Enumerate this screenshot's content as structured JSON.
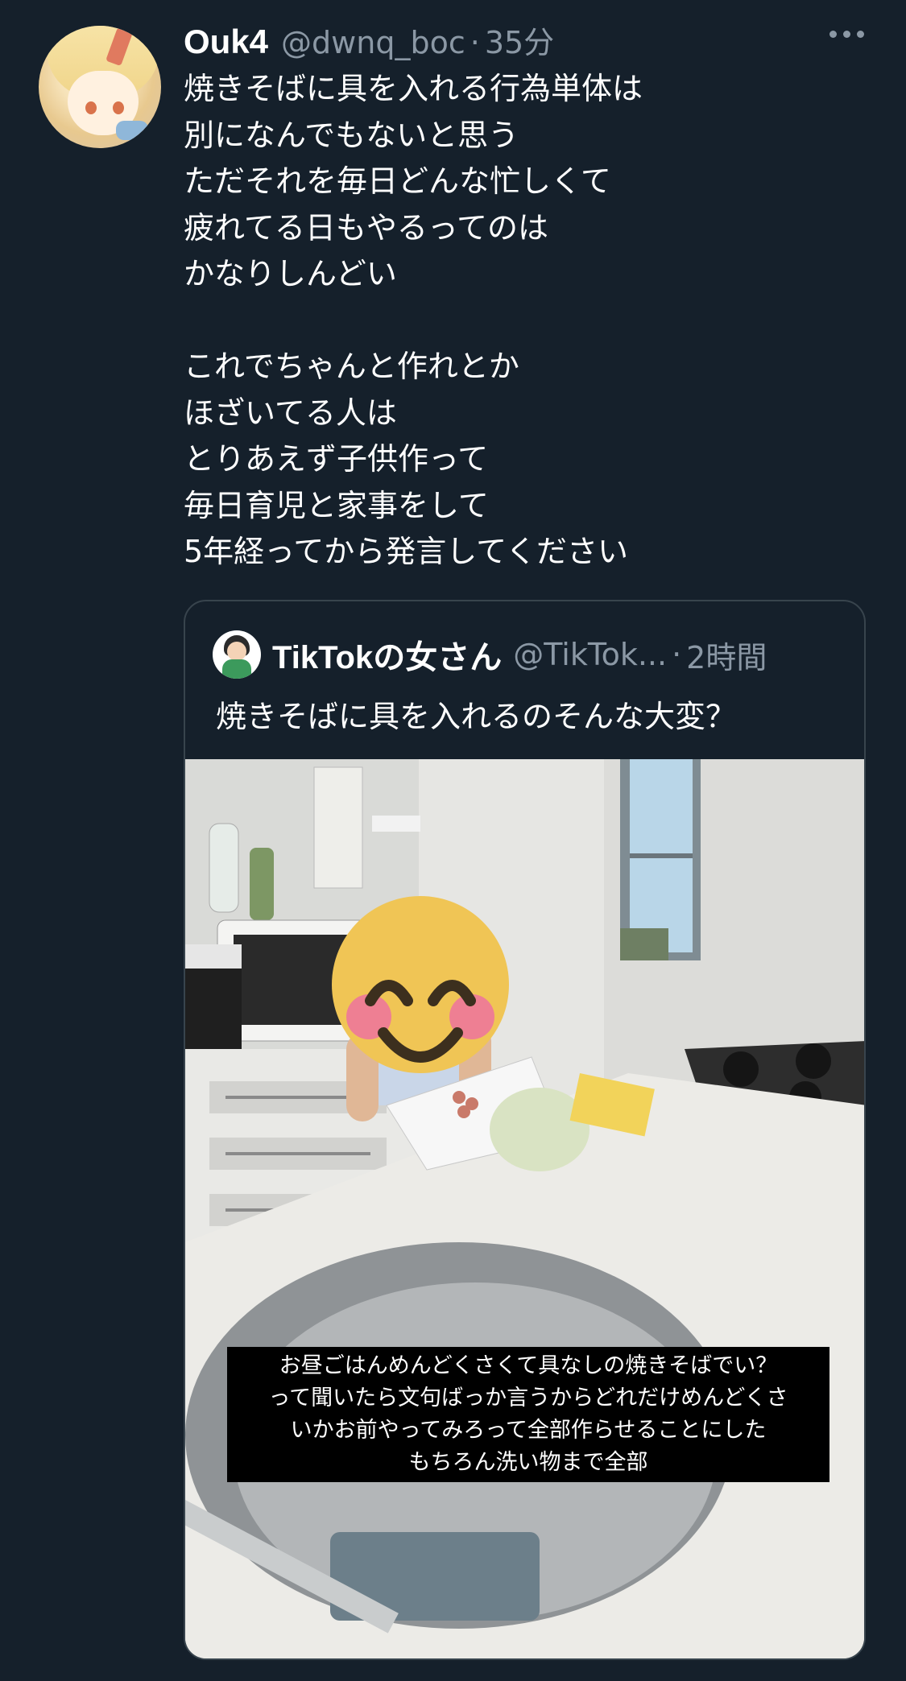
{
  "author": {
    "name": "Ouk4",
    "handle": "@dwnq_boc",
    "separator": "·",
    "time": "35分"
  },
  "tweet": {
    "lines": [
      "焼きそばに具を入れる行為単体は",
      "別になんでもないと思う",
      "ただそれを毎日どんな忙しくて",
      "疲れてる日もやるってのは",
      "かなりしんどい",
      "",
      "これでちゃんと作れとか",
      "ほざいてる人は",
      "とりあえず子供作って",
      "毎日育児と家事をして",
      "5年経ってから発言してください"
    ]
  },
  "quoted": {
    "name": "TikTokの女さん",
    "handle": "@TikTok...",
    "separator": "·",
    "time": "2時間",
    "text": "焼きそばに具を入れるのそんな大変？",
    "caption_lines": [
      "お昼ごはんめんどくさくて具なしの焼きそばでい？",
      "って聞いたら文句ばっか言うからどれだけめんどくさ",
      "いかお前やってみろって全部作らせることにした",
      "もちろん洗い物まで全部"
    ]
  },
  "icons": {
    "more": "more-horizontal-icon",
    "emoji": "smiling-face-emoji"
  },
  "colors": {
    "background": "#15202b",
    "secondary_text": "#8b98a5",
    "border": "#38444d"
  }
}
